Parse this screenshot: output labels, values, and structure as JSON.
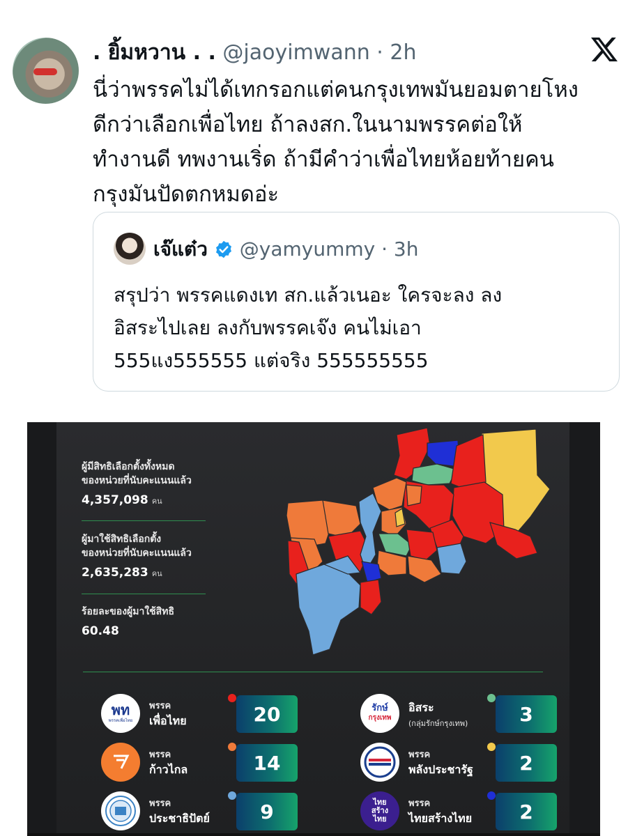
{
  "tweet": {
    "display_name": ". ยิ้มหวาน . .",
    "handle": "@jaoyimwann",
    "time": "· 2h",
    "lines": [
      "นี่ว่าพรรคไม่ได้เทกรอกแต่คนกรุงเทพมันยอมตายโหง",
      "ดีกว่าเลือกเพื่อไทย ถ้าลงสก.ในนามพรรคต่อให้",
      "ทำงานดี ทพงานเริ่ด ถ้ามีคำว่าเพื่อไทยห้อยท้ายคน",
      "กรุงมันปัดตกหมดอ่ะ"
    ],
    "logo": "x-logo-icon"
  },
  "quote": {
    "display_name": "เจ๊แต๋ว",
    "handle": "@yamyummy",
    "time": "· 3h",
    "lines": [
      "สรุปว่า พรรคแดงเท สก.แล้วเนอะ ใครจะลง ลง",
      "อิสระไปเลย ลงกับพรรคเจ๊ง คนไม่เอา",
      "555แง555555 แต่จริง 555555555"
    ],
    "verified_color": "#1d9bf0"
  },
  "infographic": {
    "stats": [
      {
        "label1": "ผู้มีสิทธิเลือกตั้งทั้งหมด",
        "label2": "ของหน่วยที่นับคะแนนแล้ว",
        "value": "4,357,098",
        "unit": "คน"
      },
      {
        "label1": "ผู้มาใช้สิทธิเลือกตั้ง",
        "label2": "ของหน่วยที่นับคะแนนแล้ว",
        "value": "2,635,283",
        "unit": "คน"
      },
      {
        "label1": "ร้อยละของผู้มาใช้สิทธิ",
        "label2": "",
        "value": "60.48",
        "unit": ""
      }
    ],
    "map_colors": {
      "pheu_thai": "#e8211d",
      "move_forward": "#ef7a3a",
      "democrat": "#6fa8dc",
      "independent": "#6cc08f",
      "palang": "#f2c94c",
      "thai_srang_thai": "#1f2fd6"
    },
    "parties": [
      {
        "pre": "พรรค",
        "name": "เพื่อไทย",
        "sub": "",
        "seats": "20",
        "dot": "#e8211d",
        "logo_text": "พท",
        "logo_caption": "พรรคเพื่อไทย",
        "logo_color": "#1c3a8f"
      },
      {
        "pre": "",
        "name": "อิสระ",
        "sub": "(กลุ่มรักษ์กรุงเทพ)",
        "seats": "3",
        "dot": "#6cc08f",
        "logo_text": "รักษ์",
        "logo_caption": "กรุงเทพ",
        "logo_color": "#2340a8"
      },
      {
        "pre": "พรรค",
        "name": "ก้าวไกล",
        "sub": "",
        "seats": "14",
        "dot": "#ef7a3a",
        "logo_text": "",
        "logo_caption": "พรรคก้าวไกล",
        "logo_color": "#f47d30"
      },
      {
        "pre": "พรรค",
        "name": "พลังประชารัฐ",
        "sub": "",
        "seats": "2",
        "dot": "#f2c94c",
        "logo_text": "",
        "logo_caption": "พลังประชารัฐ",
        "logo_color": "#1b3f8f"
      },
      {
        "pre": "พรรค",
        "name": "ประชาธิปัตย์",
        "sub": "",
        "seats": "9",
        "dot": "#6fa8dc",
        "logo_text": "",
        "logo_caption": "",
        "logo_color": "#3b82c4"
      },
      {
        "pre": "พรรค",
        "name": "ไทยสร้างไทย",
        "sub": "",
        "seats": "2",
        "dot": "#1f2fd6",
        "logo_text": "ไทย สร้าง ไทย",
        "logo_caption": "",
        "logo_color": "#3b1f8f"
      }
    ]
  }
}
